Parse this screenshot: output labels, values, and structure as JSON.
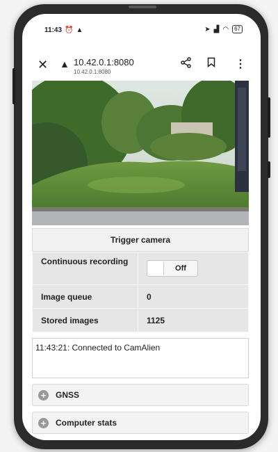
{
  "status_bar": {
    "time": "11:43",
    "left_icons": [
      "alarm-icon",
      "notification-icon"
    ],
    "right_icons": [
      "location-icon",
      "signal-icon",
      "wifi-icon"
    ],
    "battery": "67"
  },
  "browser": {
    "url": "10.42.0.1:8080",
    "url_sub": "10.42.0.1:8080",
    "icons": [
      "close-icon",
      "warning-icon",
      "share-icon",
      "bookmark-icon",
      "more-icon"
    ]
  },
  "camera": {
    "trigger_label": "Trigger camera"
  },
  "stats": {
    "continuous_label": "Continuous recording",
    "continuous_value": "Off",
    "queue_label": "Image queue",
    "queue_value": "0",
    "stored_label": "Stored images",
    "stored_value": "1125"
  },
  "log": {
    "text": "11:43:21: Connected to CamAlien"
  },
  "sections": [
    {
      "label": "GNSS"
    },
    {
      "label": "Computer stats"
    }
  ]
}
